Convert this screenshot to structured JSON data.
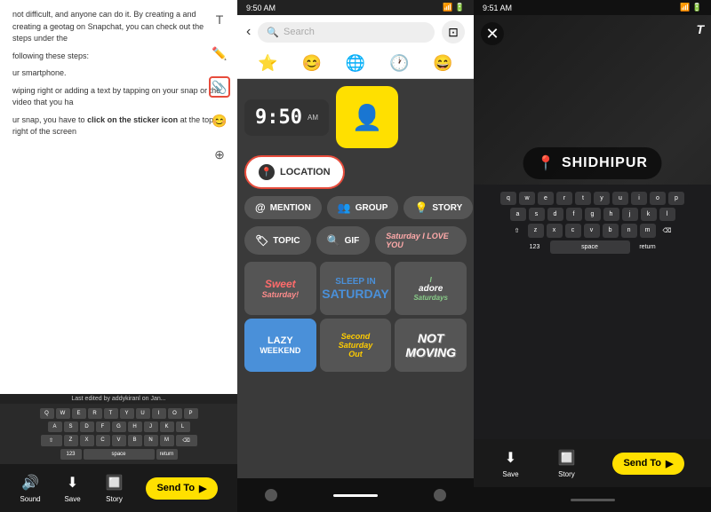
{
  "left_panel": {
    "status_bar": "Last edited by addykiranl on Jan...",
    "content_text1": "not difficult, and anyone can do it. By creating a and creating a geotag on Snapchat, you can check out the steps under the",
    "content_text2": "following these steps:",
    "content_text3": "ur smartphone.",
    "content_text4": "wiping right or adding a text by tapping on your snap or the video that you ha",
    "content_text5": "ur snap, you have to click on the sticker icon at the top right of the screen",
    "toolbar_icons": [
      "T",
      "✏",
      "📌",
      "😊"
    ],
    "bottom": {
      "sound_label": "Sound",
      "save_label": "Save",
      "story_label": "Story",
      "send_to_label": "Send To"
    }
  },
  "center_panel": {
    "status_bar": {
      "time": "9:50 AM",
      "icons": "📶 🔋"
    },
    "search_placeholder": "Search",
    "categories": [
      "⭐",
      "😊",
      "🌐",
      "🕐",
      "😄"
    ],
    "time_sticker": "9:50",
    "time_am_label": "AM",
    "location_label": "LOCATION",
    "action_buttons": [
      {
        "icon": "👤",
        "label": "MENTION"
      },
      {
        "icon": "👥",
        "label": "GROUP"
      },
      {
        "icon": "💡",
        "label": "STORY"
      }
    ],
    "topic_label": "TOPIC",
    "gif_label": "GIF",
    "stickers": [
      {
        "type": "saturday",
        "lines": [
          "Sweet",
          "Saturday"
        ]
      },
      {
        "type": "sleep",
        "lines": [
          "SLEEP IN",
          "SATURDAY"
        ]
      },
      {
        "type": "adore",
        "lines": [
          "adore",
          "Saturdays"
        ]
      },
      {
        "type": "lazy",
        "lines": [
          "LAZY",
          "WEEKEND"
        ]
      },
      {
        "type": "second",
        "lines": [
          "Second",
          "Saturday",
          "Out"
        ]
      },
      {
        "type": "notmoving",
        "lines": [
          "Not",
          "Moving"
        ]
      }
    ],
    "saturday_text": "Saturday I LOVE YOU"
  },
  "right_panel": {
    "status_bar": {
      "time": "9:51 AM",
      "icons": "📶 🔋"
    },
    "location_sticker": "SHIDHIPUR",
    "bottom": {
      "save_label": "Save",
      "story_label": "Story",
      "send_to_label": "Send To"
    }
  },
  "icons": {
    "close": "✕",
    "back": "‹",
    "search": "🔍",
    "scan": "⊡",
    "sound": "🔊",
    "save": "⬇",
    "share": "↑",
    "location_pin": "📍",
    "send_arrow": "→",
    "text_tool": "T"
  }
}
